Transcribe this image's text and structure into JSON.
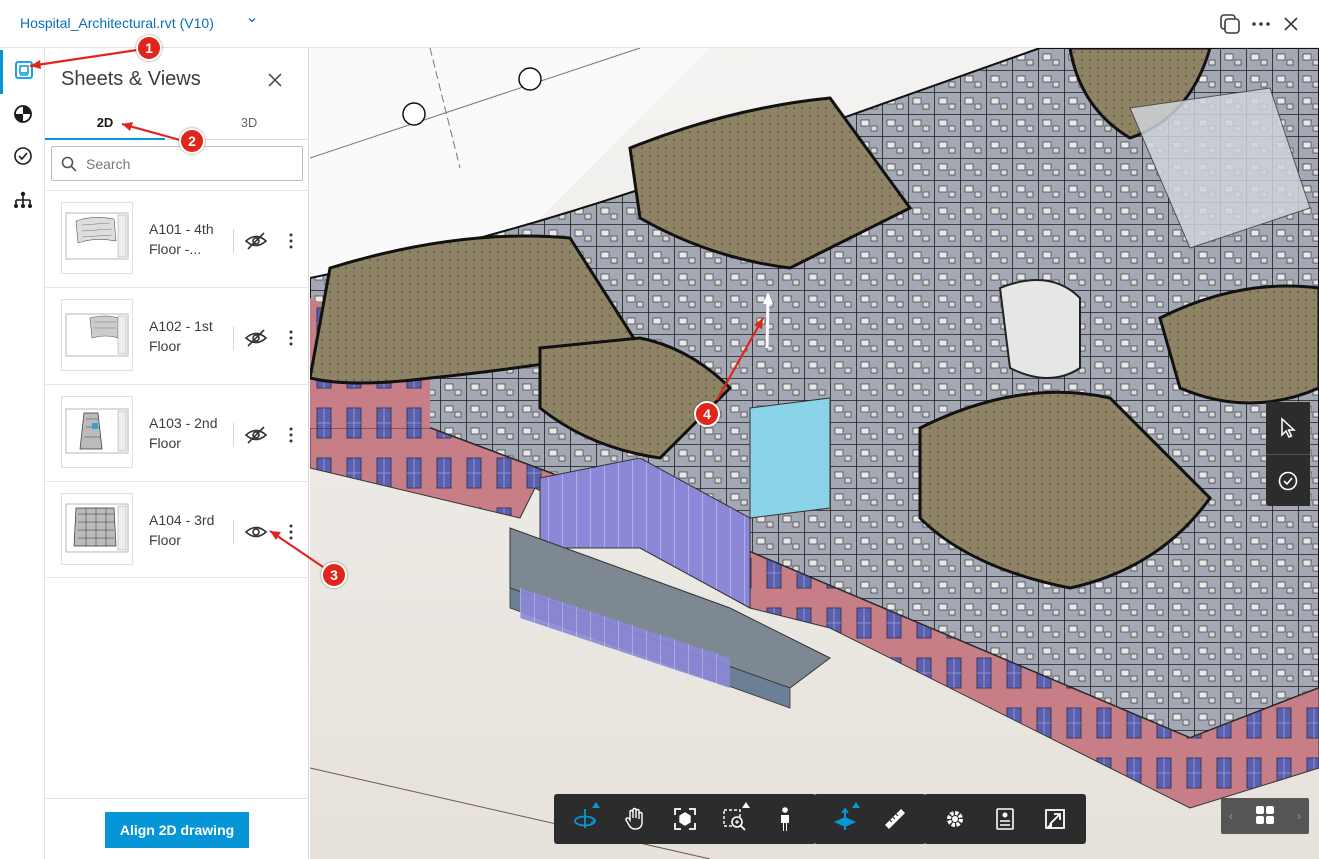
{
  "header": {
    "file_name": "Hospital_Architectural.rvt",
    "version": "(V10)"
  },
  "rail": {
    "items": [
      {
        "icon": "sheets-views-icon",
        "active": true
      },
      {
        "icon": "model-browser-icon",
        "active": false
      },
      {
        "icon": "issues-icon",
        "active": false
      },
      {
        "icon": "hierarchy-icon",
        "active": false
      }
    ]
  },
  "panel": {
    "title": "Sheets & Views",
    "tabs": [
      {
        "label": "2D",
        "active": true
      },
      {
        "label": "3D",
        "active": false
      }
    ],
    "search_placeholder": "Search",
    "sheets": [
      {
        "label": "A101 - 4th Floor -...",
        "visible": false
      },
      {
        "label": "A102 - 1st Floor",
        "visible": false
      },
      {
        "label": "A103 - 2nd Floor",
        "visible": false
      },
      {
        "label": "A104 - 3rd Floor",
        "visible": true
      }
    ],
    "align_button": "Align 2D drawing"
  },
  "annotations": [
    "1",
    "2",
    "3",
    "4"
  ],
  "toolbar": {
    "navigation": [
      "orbit-icon",
      "pan-icon",
      "fit-to-view-icon",
      "zoom-window-icon",
      "first-person-icon"
    ],
    "measure": [
      "section-plane-icon",
      "measure-icon"
    ],
    "settings": [
      "settings-icon",
      "properties-icon",
      "fullscreen-icon"
    ]
  },
  "colors": {
    "accent": "#0696d7",
    "badge": "#e1251b",
    "title_link": "#0a6fb7"
  }
}
